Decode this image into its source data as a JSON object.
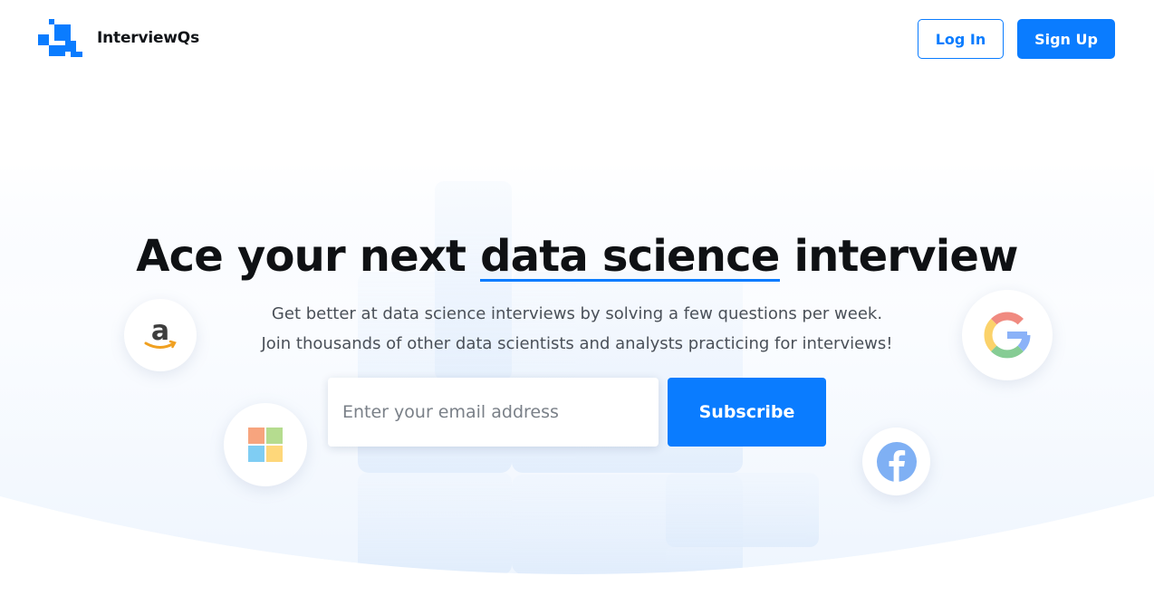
{
  "header": {
    "brand_name": "InterviewQs",
    "login_label": "Log In",
    "signup_label": "Sign Up"
  },
  "hero": {
    "headline_before": "Ace your next ",
    "headline_highlight": "data science",
    "headline_after": " interview",
    "subtitle_line1": "Get better at data science interviews by solving a few questions per week.",
    "subtitle_line2": "Join thousands of other data scientists and analysts practicing for interviews!",
    "email_placeholder": "Enter your email address",
    "subscribe_label": "Subscribe"
  },
  "company_logos": [
    "amazon-logo",
    "microsoft-logo",
    "google-logo",
    "facebook-logo"
  ],
  "colors": {
    "primary": "#0a7cff",
    "text": "#0f1114",
    "muted": "#4a5058"
  }
}
